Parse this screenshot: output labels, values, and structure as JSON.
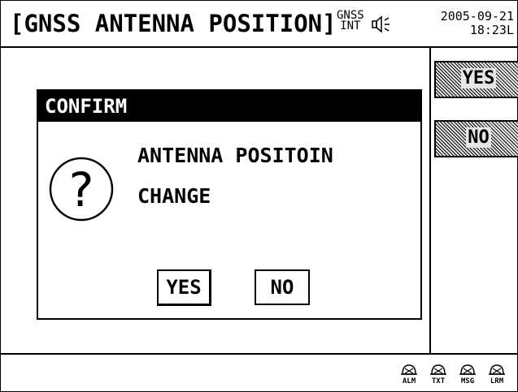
{
  "header": {
    "title": "[GNSS ANTENNA POSITION]",
    "gnss_line1": "GNSS",
    "gnss_line2": "INT",
    "speaker_icon": "speaker-icon",
    "date": "2005-09-21",
    "time": "18:23L"
  },
  "side_buttons": {
    "yes_label": "YES",
    "no_label": "NO"
  },
  "dialog": {
    "title": "CONFIRM",
    "icon": "question-icon",
    "message_line1": "ANTENNA POSITOIN",
    "message_line2": "CHANGE",
    "yes_label": "YES",
    "no_label": "NO"
  },
  "indicators": [
    {
      "icon": "bell-icon",
      "label": "ALM"
    },
    {
      "icon": "bell-icon",
      "label": "TXT"
    },
    {
      "icon": "bell-icon",
      "label": "MSG"
    },
    {
      "icon": "bell-icon",
      "label": "LRM"
    }
  ]
}
